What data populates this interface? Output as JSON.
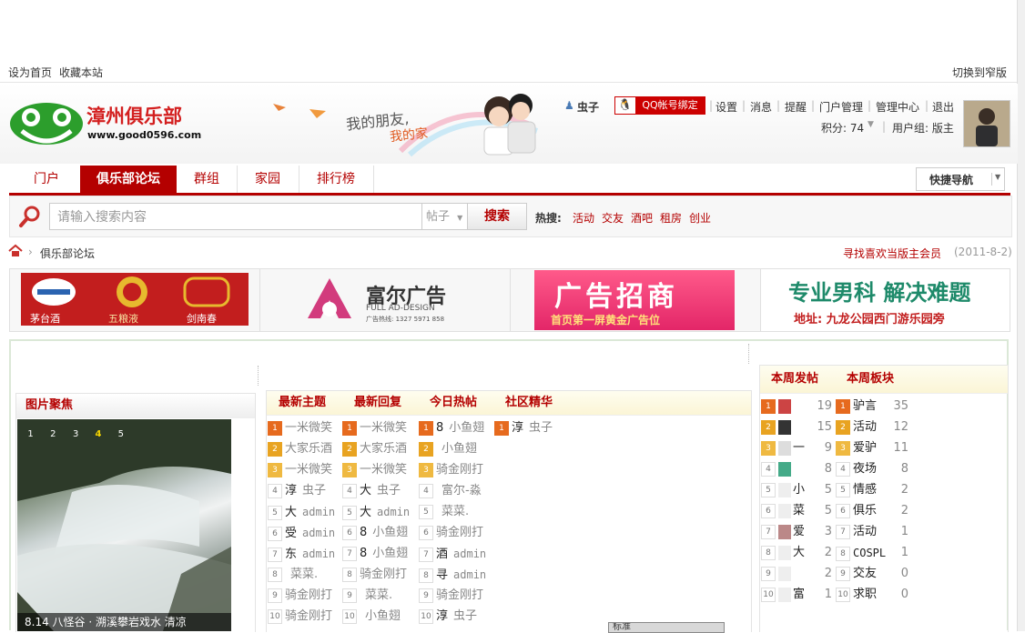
{
  "topbar": {
    "set_home": "设为首页",
    "bookmark": "收藏本站",
    "switch_width": "切换到窄版"
  },
  "logo": {
    "name": "漳州俱乐部",
    "url": "www.good0596.com"
  },
  "banner": {
    "slogan_line1": "我的朋友,",
    "slogan_line2": "我的家"
  },
  "user": {
    "name": "虫子",
    "qq_bind": "QQ帐号绑定",
    "links": [
      "设置",
      "消息",
      "提醒",
      "门户管理",
      "管理中心",
      "退出"
    ],
    "points": "积分: 74",
    "group": "用户组: 版主"
  },
  "nav": {
    "items": [
      "门户",
      "俱乐部论坛",
      "群组",
      "家园",
      "排行榜"
    ],
    "active": "俱乐部论坛",
    "quick_nav": "快捷导航"
  },
  "search": {
    "placeholder": "请输入搜索内容",
    "type": "帖子",
    "button": "搜索",
    "hot_label": "热搜:",
    "hot": [
      "活动",
      "交友",
      "酒吧",
      "租房",
      "创业"
    ]
  },
  "breadcrumb": {
    "current": "俱乐部论坛",
    "right_link": "寻找喜欢当版主会员",
    "date": "(2011-8-2)"
  },
  "ads": {
    "ad1": {
      "labels": [
        "茅台酒",
        "五粮液",
        "剑南春"
      ]
    },
    "ad2": {
      "brand": "富尔广告",
      "sub": "FULL AD-DESIGN",
      "hotline": "广告热线: 1327 5971 858"
    },
    "ad3": {
      "title": "广告招商",
      "sub": "首页第一屏黄金广告位"
    },
    "ad4": {
      "title": "专业男科 解决难题",
      "sub": "地址: 九龙公园西门游乐园旁"
    }
  },
  "photo": {
    "header": "图片聚焦",
    "pages": [
      "1",
      "2",
      "3",
      "4",
      "5"
    ],
    "active_page": "4",
    "caption": "8.14 八怪谷 · 溯溪攀岩戏水 清凉"
  },
  "tabs": [
    "最新主题",
    "最新回复",
    "今日热帖",
    "社区精华"
  ],
  "threads": {
    "col1": [
      {
        "title": "一米微笑",
        "style": "gray"
      },
      {
        "title": "大家乐酒",
        "style": "gray"
      },
      {
        "title": "一米微笑",
        "style": "gray"
      },
      {
        "title": "淳",
        "author": "虫子"
      },
      {
        "title": "大",
        "author": "admin"
      },
      {
        "title": "受",
        "author": "admin"
      },
      {
        "title": "东",
        "author": "admin"
      },
      {
        "title": "",
        "author": "菜菜."
      },
      {
        "title": "骑金刚打",
        "style": "gray"
      },
      {
        "title": "骑金刚打",
        "style": "gray"
      }
    ],
    "col2": [
      {
        "title": "一米微笑",
        "style": "gray"
      },
      {
        "title": "大家乐酒",
        "style": "gray"
      },
      {
        "title": "一米微笑",
        "style": "gray"
      },
      {
        "title": "大",
        "author": "虫子"
      },
      {
        "title": "大",
        "author": "admin"
      },
      {
        "title": "8",
        "author": "小鱼翅"
      },
      {
        "title": "8",
        "author": "小鱼翅"
      },
      {
        "title": "骑金刚打",
        "style": "gray"
      },
      {
        "title": "",
        "author": "菜菜."
      },
      {
        "title": "",
        "author": "小鱼翅"
      }
    ],
    "col3": [
      {
        "title": "8",
        "author": "小鱼翅"
      },
      {
        "title": "",
        "author": "小鱼翅"
      },
      {
        "title": "骑金刚打",
        "style": "gray"
      },
      {
        "title": "",
        "author": "富尔-淼"
      },
      {
        "title": "",
        "author": "菜菜."
      },
      {
        "title": "骑金刚打",
        "style": "gray"
      },
      {
        "title": "酒",
        "author": "admin"
      },
      {
        "title": "寻",
        "author": "admin"
      },
      {
        "title": "骑金刚打",
        "style": "gray"
      },
      {
        "title": "淳",
        "author": "虫子"
      }
    ],
    "col4": [
      {
        "title": "淳",
        "author": "虫子"
      }
    ]
  },
  "weekly": {
    "tab_posts": "本周发帖",
    "tab_boards": "本周板块",
    "posters": [
      {
        "name": "",
        "count": "19"
      },
      {
        "name": "",
        "count": "15"
      },
      {
        "name": "一",
        "count": "9"
      },
      {
        "name": "",
        "count": "8"
      },
      {
        "name": "小",
        "count": "5"
      },
      {
        "name": "菜",
        "count": "5"
      },
      {
        "name": "爱",
        "count": "3"
      },
      {
        "name": "大",
        "count": "2"
      },
      {
        "name": "",
        "count": "2"
      },
      {
        "name": "富",
        "count": "1"
      }
    ],
    "boards": [
      {
        "name": "驴言",
        "count": "35"
      },
      {
        "name": "活动",
        "count": "12"
      },
      {
        "name": "爱驴",
        "count": "11"
      },
      {
        "name": "夜场",
        "count": "8"
      },
      {
        "name": "情感",
        "count": "2"
      },
      {
        "name": "俱乐",
        "count": "2"
      },
      {
        "name": "活动",
        "count": "1"
      },
      {
        "name": "COSPL",
        "count": "1"
      },
      {
        "name": "交友",
        "count": "0"
      },
      {
        "name": "求职",
        "count": "0"
      }
    ]
  },
  "taskbar": {
    "label": "标准"
  }
}
